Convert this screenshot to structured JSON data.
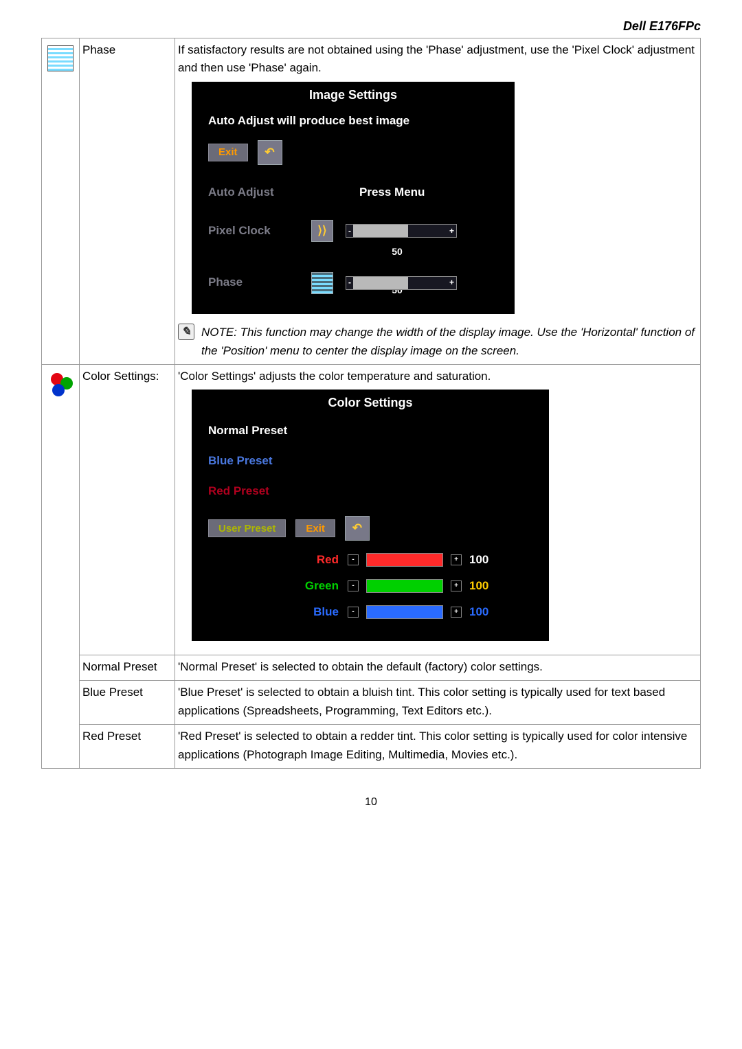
{
  "header": {
    "product": "Dell E176FPc"
  },
  "pageNumber": "10",
  "rows": {
    "phase": {
      "label": "Phase",
      "desc": "If satisfactory results are not obtained using the 'Phase' adjustment, use the 'Pixel Clock' adjustment and then use 'Phase' again.",
      "note": "NOTE: This function may change the width of the display image. Use the 'Horizontal' function of the 'Position' menu to center the display image on the screen."
    },
    "color": {
      "label": "Color Settings:",
      "desc": "'Color Settings' adjusts the color temperature and saturation.",
      "normal": {
        "label": "Normal Preset",
        "desc": "'Normal Preset' is selected to obtain the default (factory) color settings."
      },
      "blue": {
        "label": "Blue Preset",
        "desc": "'Blue Preset' is selected to obtain a bluish tint. This color setting is typically used for text based applications (Spreadsheets, Programming, Text Editors etc.)."
      },
      "red": {
        "label": "Red Preset",
        "desc": "'Red Preset' is selected to obtain a redder tint. This color setting is typically used for color intensive applications (Photograph Image Editing, Multimedia, Movies etc.)."
      }
    }
  },
  "osd_image": {
    "title": "Image Settings",
    "heading": "Auto Adjust will produce best image",
    "exit": "Exit",
    "autoAdj": "Auto Adjust",
    "pressMenu": "Press Menu",
    "pixelClock": {
      "label": "Pixel Clock",
      "value": "50"
    },
    "phase": {
      "label": "Phase",
      "value": "50"
    }
  },
  "osd_color": {
    "title": "Color Settings",
    "normal": "Normal Preset",
    "blue": "Blue Preset",
    "red": "Red Preset",
    "user": "User Preset",
    "exit": "Exit",
    "sliders": {
      "red": {
        "label": "Red",
        "value": "100"
      },
      "green": {
        "label": "Green",
        "value": "100"
      },
      "blue": {
        "label": "Blue",
        "value": "100"
      }
    }
  }
}
